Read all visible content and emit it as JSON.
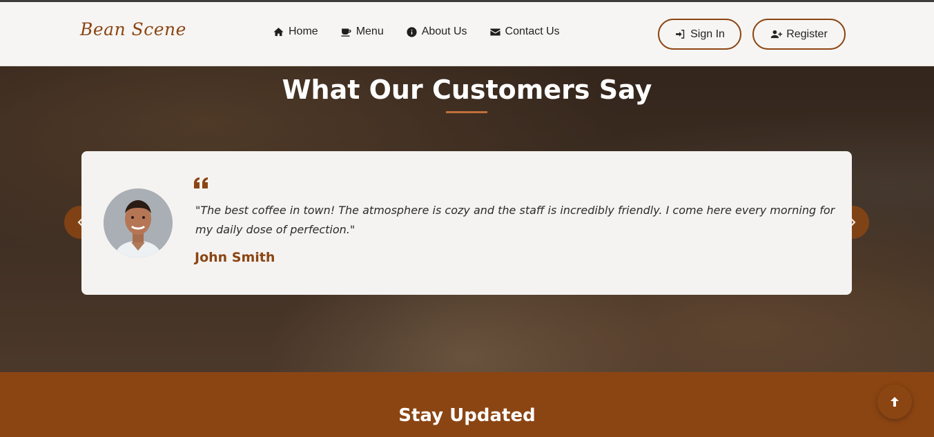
{
  "header": {
    "logo": "Bean Scene",
    "nav": [
      {
        "label": "Home",
        "icon": "home-icon"
      },
      {
        "label": "Menu",
        "icon": "coffee-cup-icon"
      },
      {
        "label": "About Us",
        "icon": "info-circle-icon"
      },
      {
        "label": "Contact Us",
        "icon": "envelope-icon"
      }
    ],
    "sign_in": {
      "label": "Sign In",
      "icon": "sign-in-icon"
    },
    "register": {
      "label": "Register",
      "icon": "user-plus-icon"
    }
  },
  "testimonials": {
    "title": "What Our Customers Say",
    "quote": "\"The best coffee in town! The atmosphere is cozy and the staff is incredibly friendly. I come here every morning for my daily dose of perfection.\"",
    "author": "John Smith",
    "prev_icon": "chevron-left-icon",
    "next_icon": "chevron-right-icon"
  },
  "newsletter": {
    "title": "Stay Updated"
  },
  "back_to_top": {
    "icon": "arrow-up-icon"
  },
  "colors": {
    "accent": "#8b4513",
    "header_bg": "#f6f5f3",
    "card_bg": "#f5f3f1"
  }
}
